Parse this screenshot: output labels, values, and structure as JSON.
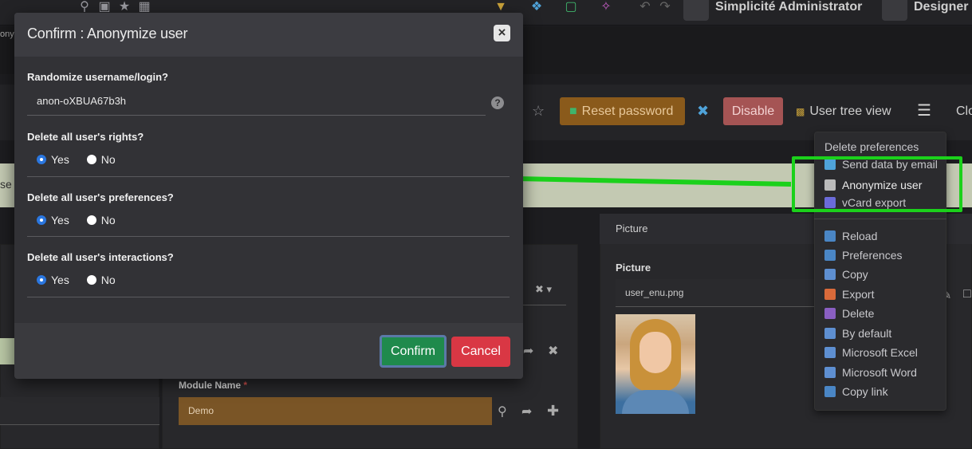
{
  "topbar": {
    "user_name": "Simplicité Administrator",
    "designer": "Designer",
    "crumb": "ony"
  },
  "toolbar": {
    "reset_password": "Reset password",
    "disable": "Disable",
    "user_tree_view": "User tree view",
    "close": "Clo"
  },
  "strip_text": "se t",
  "picture_panel": {
    "header": "Picture",
    "label": "Picture",
    "file": "user_enu.png"
  },
  "module": {
    "label": "Module Name",
    "required": "*",
    "value": "Demo"
  },
  "dropdown": {
    "items": [
      {
        "label": "Delete preferences",
        "icon": "none",
        "color": "#c8c8cc"
      },
      {
        "label": "Send data by email",
        "icon": "at-icon",
        "color": "#4fa3d9"
      },
      {
        "label": "Anonymize user",
        "icon": "spy-icon",
        "color": "#bbbbbb"
      },
      {
        "label": "vCard export",
        "icon": "vcard-icon",
        "color": "#6b6bd9"
      },
      {
        "label": "Reload",
        "icon": "reload-icon",
        "color": "#4a86c5"
      },
      {
        "label": "Preferences",
        "icon": "preferences-icon",
        "color": "#4a86c5"
      },
      {
        "label": "Copy",
        "icon": "copy-icon",
        "color": "#5e8fd1"
      },
      {
        "label": "Export",
        "icon": "export-icon",
        "color": "#d96a3a"
      },
      {
        "label": "Delete",
        "icon": "trash-icon",
        "color": "#8a5fc2"
      },
      {
        "label": "By default",
        "icon": "default-icon",
        "color": "#5e8fd1"
      },
      {
        "label": "Microsoft Excel",
        "icon": "excel-icon",
        "color": "#5e8fd1"
      },
      {
        "label": "Microsoft Word",
        "icon": "word-icon",
        "color": "#5e8fd1"
      },
      {
        "label": "Copy link",
        "icon": "link-icon",
        "color": "#4a86c5"
      }
    ]
  },
  "modal": {
    "title": "Confirm : Anonymize user",
    "q1": "Randomize username/login?",
    "username_value": "anon-oXBUA67b3h",
    "q2": "Delete all user's rights?",
    "q3": "Delete all user's preferences?",
    "q4": "Delete all user's interactions?",
    "yes": "Yes",
    "no": "No",
    "confirm": "Confirm",
    "cancel": "Cancel",
    "help": "?"
  },
  "colors": {
    "highlight": "#1bd11b",
    "confirm": "#1f8a4c",
    "cancel": "#d93744",
    "reset": "#8a5a1b",
    "disable": "#a55454"
  }
}
